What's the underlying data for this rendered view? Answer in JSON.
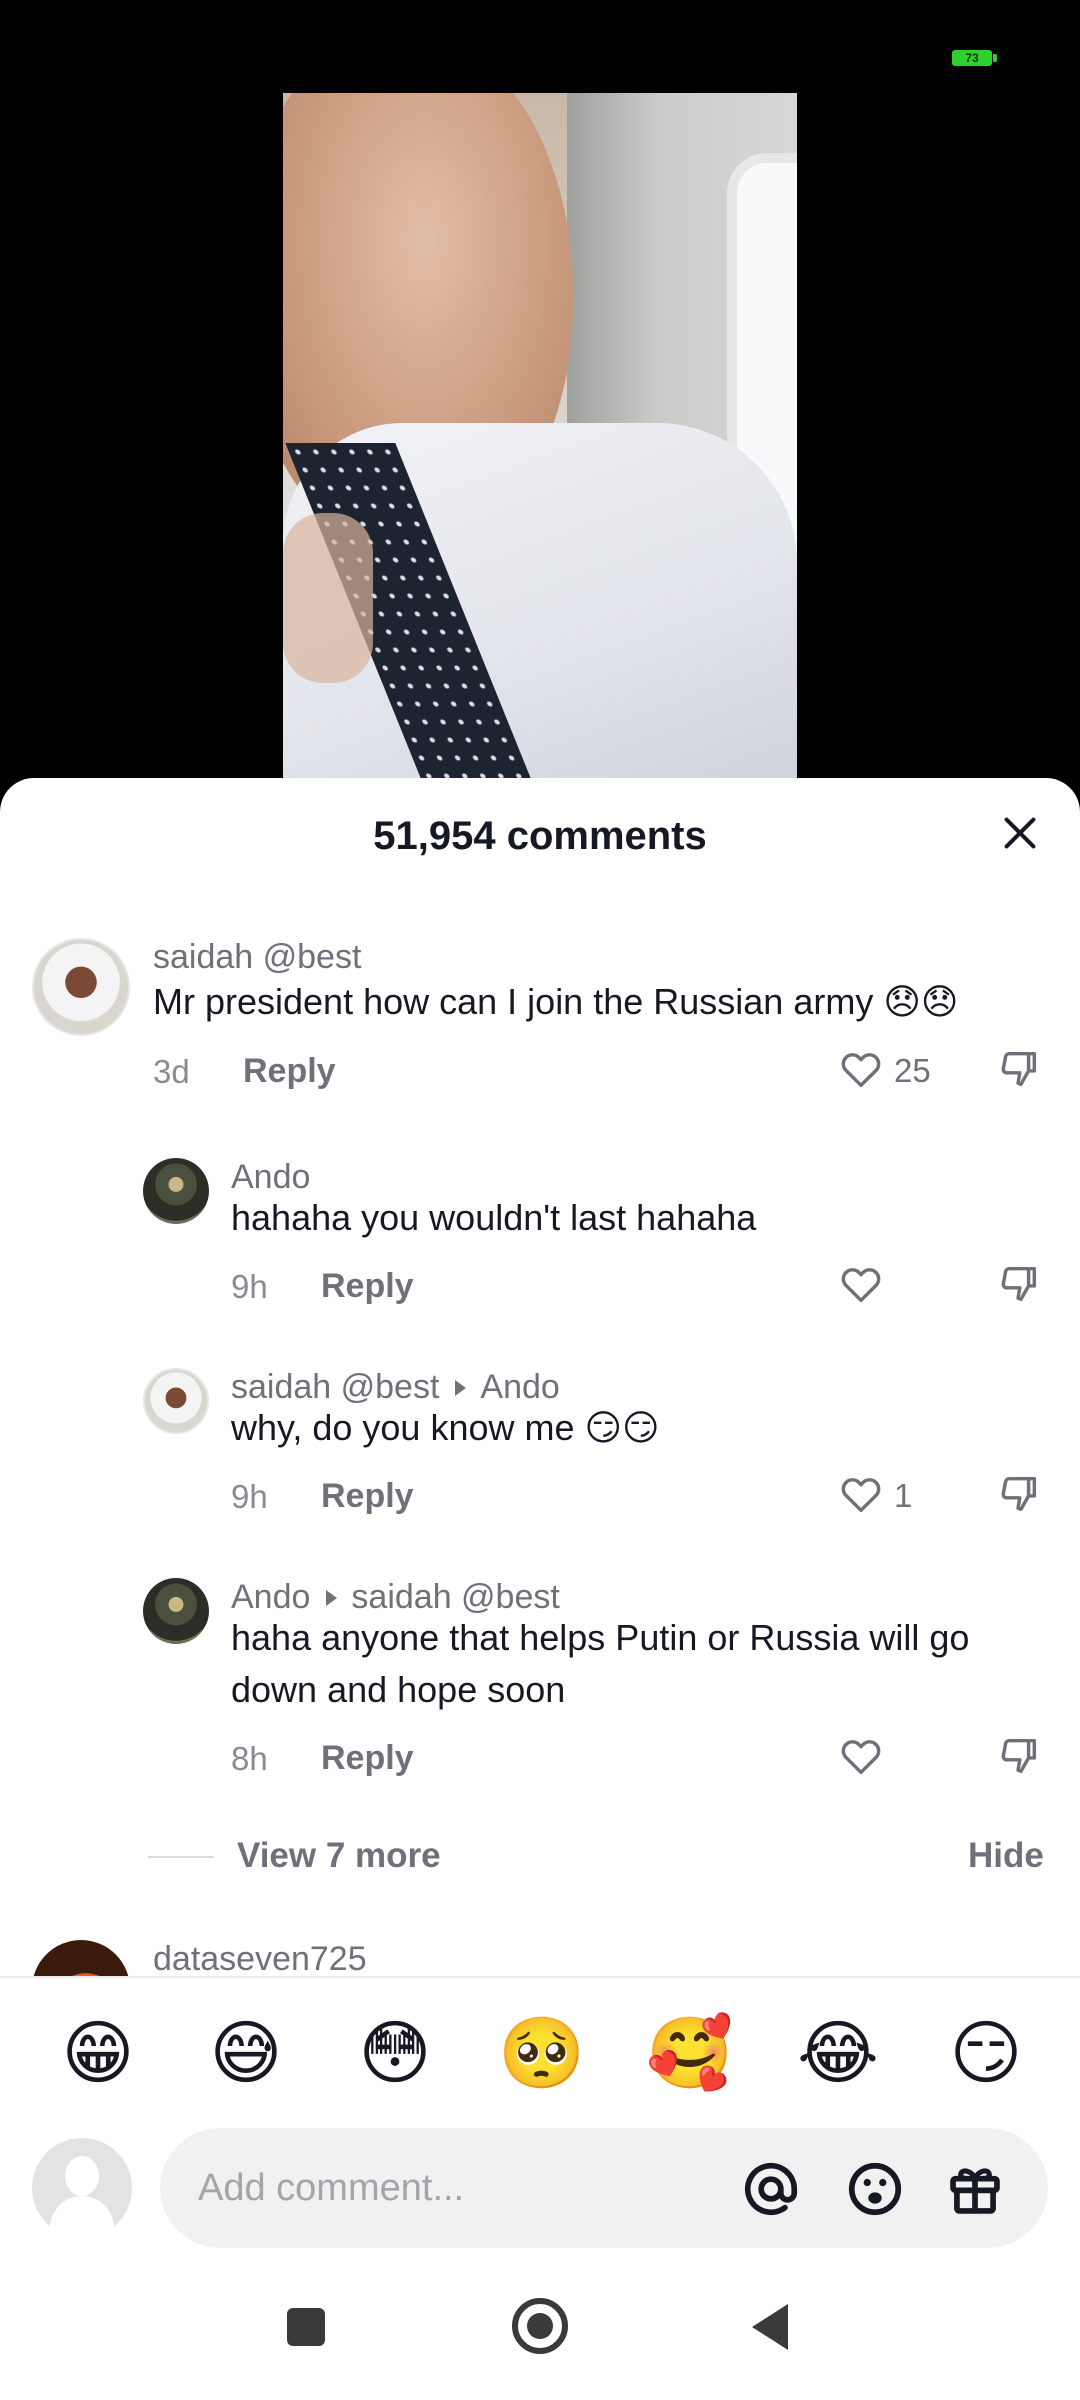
{
  "status_bar": {
    "battery": "73"
  },
  "sheet": {
    "title": "51,954 comments"
  },
  "comments": [
    {
      "name": "saidah @best",
      "text": "Mr president how can I join the Russian army 😞😞",
      "time": "3d",
      "reply_label": "Reply",
      "likes": "25"
    },
    {
      "name": "Ando",
      "text": "hahaha you wouldn't last hahaha",
      "time": "9h",
      "reply_label": "Reply",
      "likes": ""
    },
    {
      "name": "saidah @best",
      "reply_to": "Ando",
      "text": "why, do you know me 😏😏",
      "time": "9h",
      "reply_label": "Reply",
      "likes": "1"
    },
    {
      "name": "Ando",
      "reply_to": "saidah @best",
      "text": "haha anyone that helps Putin or Russia will go down and hope soon",
      "time": "8h",
      "reply_label": "Reply",
      "likes": ""
    }
  ],
  "view_more": {
    "label": "View 7 more",
    "hide_label": "Hide"
  },
  "next_comment": {
    "name": "dataseven725"
  },
  "emojis": [
    "😁",
    "😅",
    "😳",
    "🥺",
    "🥰",
    "😂",
    "😏"
  ],
  "input": {
    "placeholder": "Add comment..."
  },
  "colors": {
    "like_icon": "#6f7079",
    "text": "#161823",
    "muted": "#6f7079",
    "battery": "#2fd12f"
  }
}
